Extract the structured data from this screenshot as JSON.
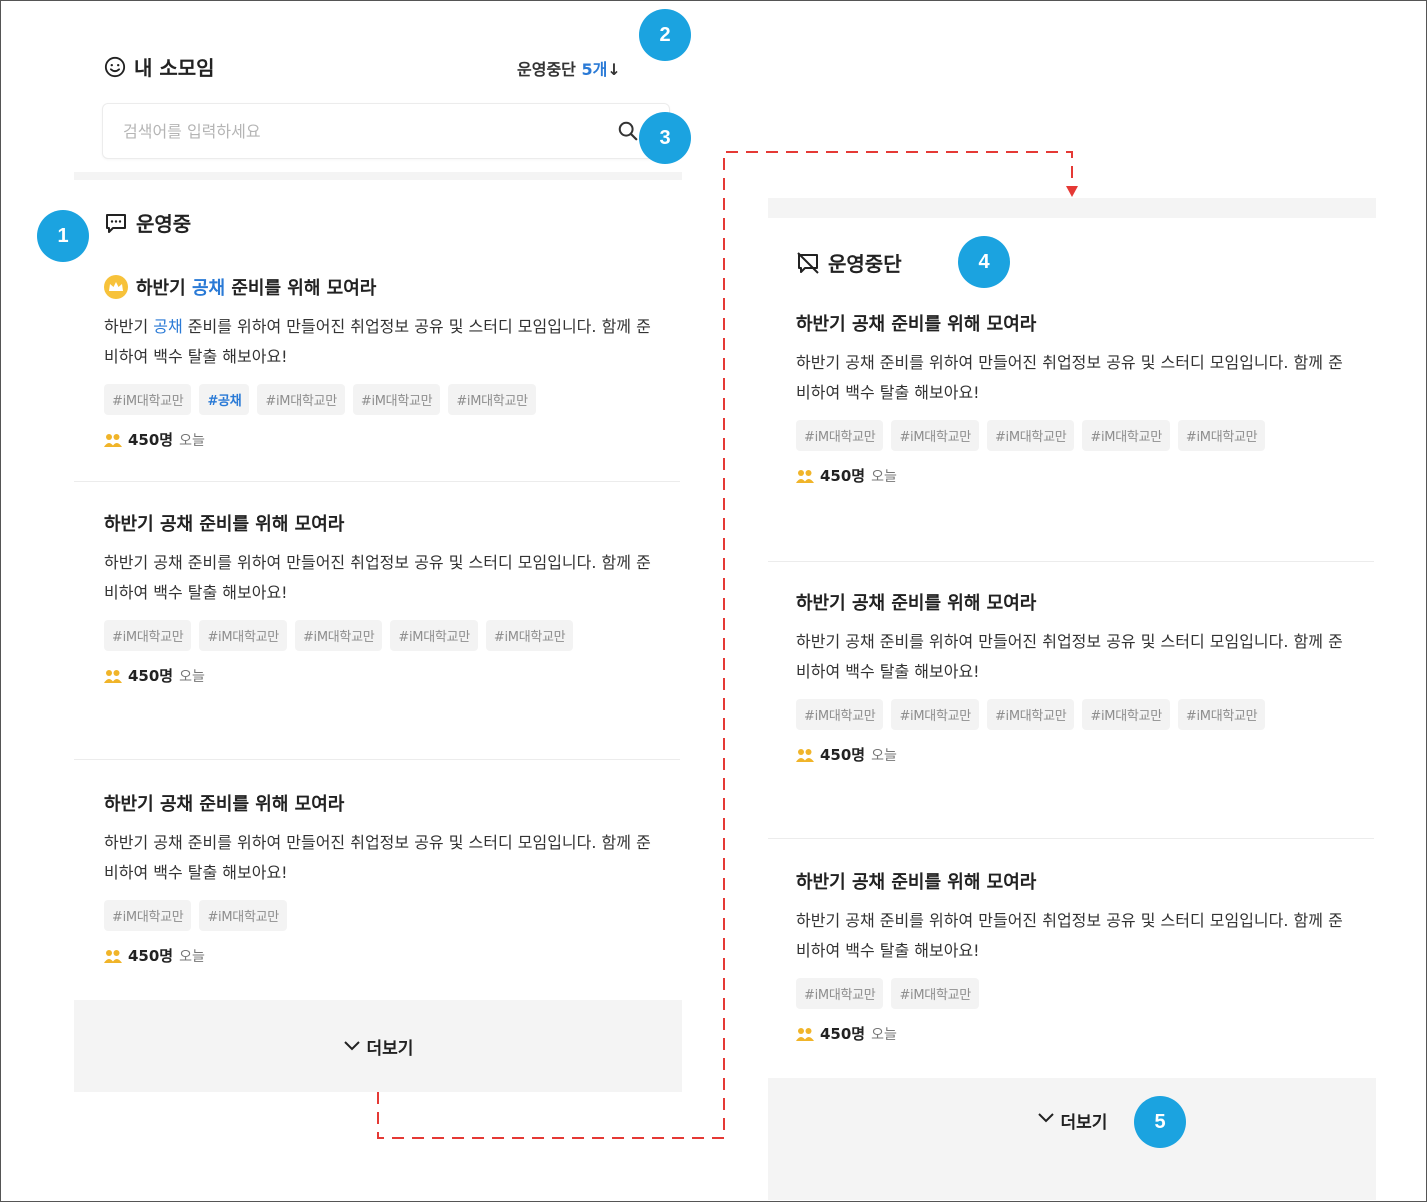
{
  "header": {
    "title": "내 소모임",
    "closed_label": "운영중단",
    "closed_count": "5개",
    "closed_arrow": "↓"
  },
  "search": {
    "placeholder": "검색어를 입력하세요"
  },
  "badges": [
    "1",
    "2",
    "3",
    "4",
    "5"
  ],
  "active": {
    "title": "운영중",
    "cards": [
      {
        "title_pre": "하반기 ",
        "title_hl": "공채",
        "title_post": " 준비를 위해 모여라",
        "desc_pre": "하반기 ",
        "desc_hl": "공채",
        "desc_post": " 준비를 위하여 만들어진 취업정보 공유 및 스터디 모임입니다. 함께 준비하여 백수 탈출 해보아요!",
        "tags": [
          "#iM대학교만",
          "#공채",
          "#iM대학교만",
          "#iM대학교만",
          "#iM대학교만"
        ],
        "count": "450명",
        "when": "오늘"
      },
      {
        "title": "하반기 공채 준비를 위해 모여라",
        "desc": "하반기 공채 준비를 위하여 만들어진 취업정보 공유 및 스터디 모임입니다. 함께 준비하여 백수 탈출 해보아요!",
        "tags": [
          "#iM대학교만",
          "#iM대학교만",
          "#iM대학교만",
          "#iM대학교만",
          "#iM대학교만"
        ],
        "count": "450명",
        "when": "오늘"
      },
      {
        "title": "하반기 공채 준비를 위해 모여라",
        "desc": "하반기 공채 준비를 위하여 만들어진 취업정보 공유 및 스터디 모임입니다. 함께 준비하여 백수 탈출 해보아요!",
        "tags": [
          "#iM대학교만",
          "#iM대학교만"
        ],
        "count": "450명",
        "when": "오늘"
      }
    ],
    "more_label": "더보기"
  },
  "closed": {
    "title": "운영중단",
    "cards": [
      {
        "title": "하반기 공채 준비를 위해 모여라",
        "desc": "하반기 공채 준비를 위하여 만들어진 취업정보 공유 및 스터디 모임입니다. 함께 준비하여 백수 탈출 해보아요!",
        "tags": [
          "#iM대학교만",
          "#iM대학교만",
          "#iM대학교만",
          "#iM대학교만",
          "#iM대학교만"
        ],
        "count": "450명",
        "when": "오늘"
      },
      {
        "title": "하반기 공채 준비를 위해 모여라",
        "desc": "하반기 공채 준비를 위하여 만들어진 취업정보 공유 및 스터디 모임입니다. 함께 준비하여 백수 탈출 해보아요!",
        "tags": [
          "#iM대학교만",
          "#iM대학교만",
          "#iM대학교만",
          "#iM대학교만",
          "#iM대학교만"
        ],
        "count": "450명",
        "when": "오늘"
      },
      {
        "title": "하반기 공채 준비를 위해 모여라",
        "desc": "하반기 공채 준비를 위하여 만들어진 취업정보 공유 및 스터디 모임입니다. 함께 준비하여 백수 탈출 해보아요!",
        "tags": [
          "#iM대학교만",
          "#iM대학교만"
        ],
        "count": "450명",
        "when": "오늘"
      }
    ],
    "more_label": "더보기"
  },
  "colors": {
    "accent": "#2a7ad6",
    "badge": "#1ba3e0",
    "crown": "#f7c23a",
    "people": "#f0b429",
    "connector": "#e53935"
  }
}
